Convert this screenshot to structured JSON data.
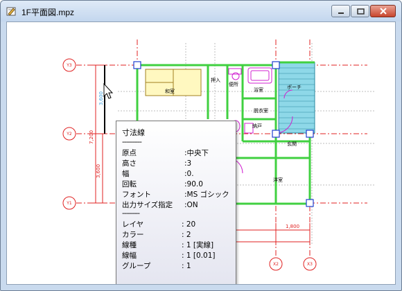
{
  "window": {
    "title": "1F平面図.mpz",
    "accent": "#c3d6ee",
    "close_color": "#c8452d"
  },
  "grid_labels": {
    "y3": "Y3",
    "y2": "Y2",
    "y1": "Y1",
    "x2": "X2",
    "x3": "X3"
  },
  "dims": {
    "left_top": "7,200",
    "left_bottom": "3,600",
    "bottom_right": "1,800",
    "partial": "3,600"
  },
  "rooms": {
    "washitsu": "和室",
    "oshiire": "押入",
    "yokushitsu": "浴室",
    "porch": "ポーチ",
    "datsuijo": "脱衣室",
    "todana": "納戸",
    "genkan": "玄関",
    "yoshitsu": "洋室",
    "benjo": "便所"
  },
  "tooltip": {
    "title": "寸法線",
    "separator": "----------",
    "fields": [
      {
        "key": "原点",
        "value": ":中央下"
      },
      {
        "key": "高さ",
        "value": ":3"
      },
      {
        "key": "幅",
        "value": ":0."
      },
      {
        "key": "回転",
        "value": ":90.0"
      },
      {
        "key": "フォント",
        "value": ":MS ゴシック"
      },
      {
        "key": "出力サイズ指定",
        "value": ":ON"
      }
    ],
    "separator2": "---------",
    "attrs": [
      {
        "key": "レイヤ",
        "value": ":   20"
      },
      {
        "key": "カラー",
        "value": ":    2"
      },
      {
        "key": "線種",
        "value": ":    1 [実線]"
      },
      {
        "key": "線幅",
        "value": ":    1 [0.01]"
      },
      {
        "key": "グループ",
        "value": ":    1"
      }
    ]
  }
}
